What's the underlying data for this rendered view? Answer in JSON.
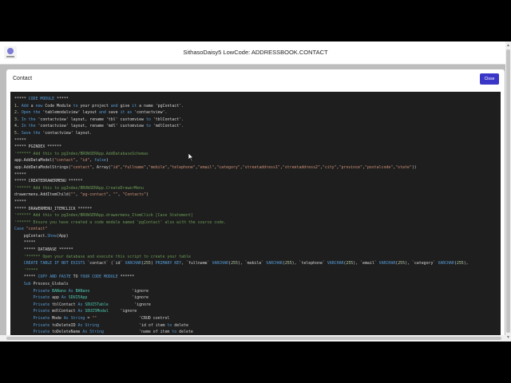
{
  "app": {
    "title": "SithasoDaisy5 LowCode: ADDRESSBOOK.CONTACT"
  },
  "modal": {
    "title": "Contact",
    "close_label": "Close"
  },
  "code_lines": [
    "***** CODE MODULE *****",
    "1. Add a new Code Module to your project and give it a name 'pgContact'.",
    "2. Open the 'tablemodalview' layout and save it as 'contactview'.",
    "3. In the 'contactview' layout, rename 'tbl' customview to 'tblContact'.",
    "4. In the 'contactview' layout, rename 'mdl' customview to 'mdlContact'.",
    "5. Save the 'contactview' layout.",
    "*****",
    "***** PGINDEX ******",
    "'****** Add this to pgIndex/BROWSERApp.AddDatabaseSchemas",
    "app.AddDataModel(\"contact\", \"id\", false)",
    "app.AddDataModelStrings(\"contact\", Array(\"id\",\"fullname\",\"mobile\",\"telephone\",\"email\",\"category\",\"streetaddress1\",\"streetaddress2\",\"city\",\"province\",\"postalcode\",\"state\"))",
    "*****",
    "***** CREATEDRAWERMENU ******",
    "'****** Add this to pgIndex/BROWSERApp.CreateDrawerMenu",
    "drawermenu.AddItemChild(\"\", \"pg-contact\", \"\", \"Contacts\")",
    "*****",
    "***** DRAWERMENU_ITEMCLICK ******",
    "'****** Add this to pgIndex/BROWSERApp.drawermenu_ItemClick [Case Statement]",
    "'****** Ensure you have created a code module named 'pgContact' also with the source code.",
    "Case \"contact\"",
    "    pgContact.Show(App)",
    "    *****",
    "    ***** DATABASE ******",
    "    '****** Open your database and execute this script to create your table",
    "    CREATE TABLE IF NOT EXISTS `contact` (`id` VARCHAR(255) PRIMARY KEY, `fullname` VARCHAR(255), `mobile` VARCHAR(255), `telephone` VARCHAR(255), `email` VARCHAR(255), `category` VARCHAR(255),",
    "    '*****",
    "    ***** COPY AND PASTE TO YOUR CODE MODULE ******",
    "    Sub Process_Globals",
    "        Private BANano As BANano                  'ignore",
    "        Private app As SDUI5App                   'ignore",
    "        Private tblContact As SDUI5Table           'ignore",
    "        Private mdlContact As SDUI5Modal     'ignore",
    "        Private Mode As String = \"\"                  'CRUD control",
    "        Private toDeleteID As String                 'id of item to delete",
    "        Private toDeleteName As String               'name of item to delete"
  ],
  "colors": {
    "accent": "#3a36c8",
    "code_bg": "#1e1e1e",
    "keyword": "#569cd6",
    "comment": "#6a9955",
    "string": "#ce9178",
    "type": "#4ec9b0",
    "number": "#b5cea8"
  }
}
